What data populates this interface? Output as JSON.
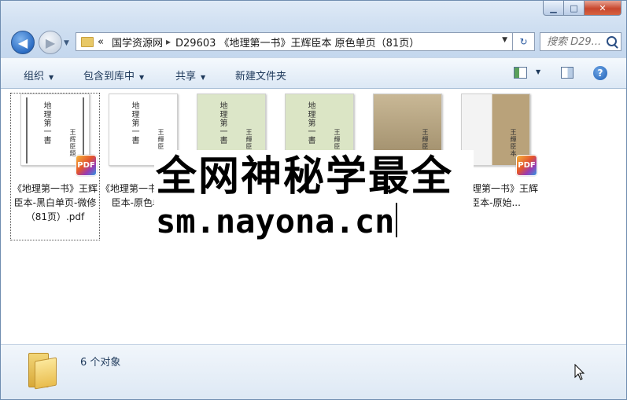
{
  "window": {
    "caption_buttons": {
      "minimize": "▁",
      "maximize": "□",
      "close": "✕"
    }
  },
  "nav": {
    "back_icon": "◀",
    "forward_icon": "▶",
    "history_icon": "▼"
  },
  "address": {
    "overflow": "«",
    "crumbs": [
      "国学资源网",
      "D29603 《地理第一书》王辉臣本 原色单页（81页）"
    ],
    "separator": "▸",
    "refresh_icon": "↻",
    "dropdown_icon": "▼"
  },
  "search": {
    "placeholder": "搜索 D29..."
  },
  "toolbar": {
    "organize": "组织",
    "include_library": "包含到库中",
    "share": "共享",
    "new_folder": "新建文件夹",
    "help": "?"
  },
  "files": [
    {
      "name": "《地理第一书》王辉臣本-黑白单页-微修（81页）.pdf",
      "thumb_title": "地理第一書",
      "thumb_author": "王辉臣題",
      "tint": "#ffffff",
      "selected": true
    },
    {
      "name": "《地理第一书》王辉臣本-原色单页-",
      "thumb_title": "地理第一書",
      "thumb_author": "王輝臣本",
      "tint": "#ffffff"
    },
    {
      "name": "",
      "thumb_title": "地理第一書",
      "thumb_author": "王輝臣本",
      "tint": "#dce6c8"
    },
    {
      "name": "",
      "thumb_title": "地理第一書",
      "thumb_author": "王輝臣本",
      "tint": "#dbe5c5"
    },
    {
      "name": "",
      "thumb_title": "",
      "thumb_author": "王輝臣本",
      "tint": "#b9a98a"
    },
    {
      "name": "《地理第一书》王辉臣本-原始...",
      "thumb_title": "",
      "thumb_author": "王輝臣本",
      "tint": "#efefef"
    }
  ],
  "pdf_badge": "PDF",
  "overlay": {
    "line1": "全网神秘学最全",
    "line2": "sm.nayona.cn"
  },
  "details": {
    "count": "6 个对象"
  }
}
